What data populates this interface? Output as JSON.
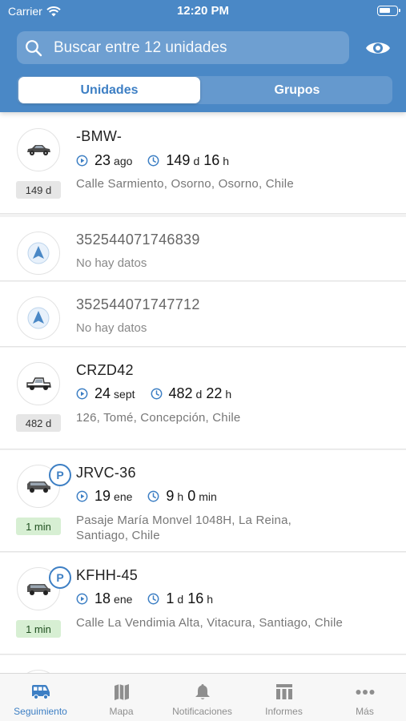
{
  "status_bar": {
    "carrier": "Carrier",
    "time": "12:20 PM"
  },
  "search": {
    "placeholder": "Buscar entre 12 unidades"
  },
  "segments": {
    "active": "Unidades",
    "inactive": "Grupos"
  },
  "units": [
    {
      "name": "-BMW-",
      "icon": "car-icon",
      "date_num": "23",
      "date_month": "ago",
      "dur1": "149",
      "dur1_unit": "d",
      "dur2": "16",
      "dur2_unit": "h",
      "address": "Calle Sarmiento, Osorno, Osorno, Chile",
      "badge": "149 d",
      "badge_color": "#e6e6e6"
    },
    {
      "name": "352544071746839",
      "icon": "navigation-arrow-icon",
      "status": "No hay datos"
    },
    {
      "name": "352544071747712",
      "icon": "navigation-arrow-icon",
      "status": "No hay datos"
    },
    {
      "name": "CRZD42",
      "icon": "pickup-truck-icon",
      "date_num": "24",
      "date_month": "sept",
      "dur1": "482",
      "dur1_unit": "d",
      "dur2": "22",
      "dur2_unit": "h",
      "address": "126, Tomé, Concepción, Chile",
      "badge": "482 d",
      "badge_color": "#e6e6e6"
    },
    {
      "name": "JRVC-36",
      "icon": "van-icon",
      "parking": "P",
      "date_num": "19",
      "date_month": "ene",
      "dur1": "9",
      "dur1_unit": "h",
      "dur2": "0",
      "dur2_unit": "min",
      "address_line1": "Pasaje María Monvel 1048H, La Reina,",
      "address_line2": "Santiago, Chile",
      "badge": "1 min",
      "badge_color": "#d7efd3"
    },
    {
      "name": "KFHH-45",
      "icon": "van-icon",
      "parking": "P",
      "date_num": "18",
      "date_month": "ene",
      "dur1": "1",
      "dur1_unit": "d",
      "dur2": "16",
      "dur2_unit": "h",
      "address": "Calle La Vendimia Alta, Vitacura, Santiago, Chile",
      "badge": "1 min",
      "badge_color": "#d7efd3"
    }
  ],
  "tabbar": {
    "items": [
      {
        "label": "Seguimiento",
        "icon": "bus-icon",
        "active": true
      },
      {
        "label": "Mapa",
        "icon": "map-icon"
      },
      {
        "label": "Notificaciones",
        "icon": "bell-icon"
      },
      {
        "label": "Informes",
        "icon": "table-icon"
      },
      {
        "label": "Más",
        "icon": "more-dots-icon"
      }
    ]
  },
  "colors": {
    "header": "#4a88c6",
    "accent": "#3d7fc4",
    "badge_green": "#d7efd3",
    "badge_gray": "#e6e6e6"
  }
}
